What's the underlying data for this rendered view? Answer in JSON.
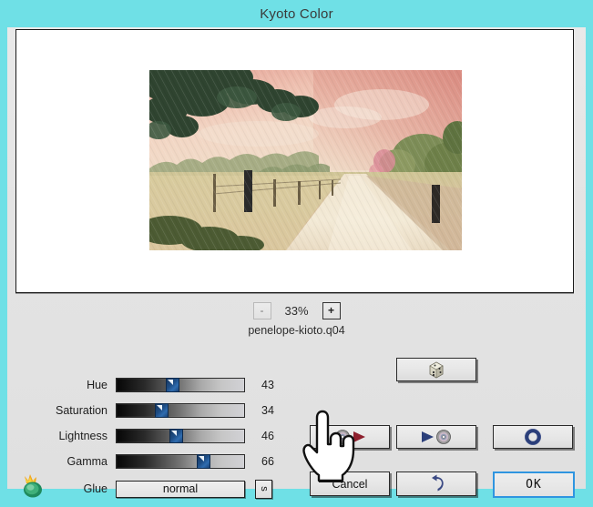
{
  "window": {
    "title": "Kyoto Color",
    "titlebar_color": "#6fe0e6",
    "panel_color": "#e5e5e5"
  },
  "preview": {
    "image_name": "penelope-kioto.q04",
    "background": "#ffffff",
    "description": "landscape painting of a dirt road with fence posts, trees and pink sky"
  },
  "zoom": {
    "minus_label": "-",
    "value": "33%",
    "plus_label": "+"
  },
  "sliders": [
    {
      "label": "Hue",
      "value": "43",
      "percent": 43
    },
    {
      "label": "Saturation",
      "value": "34",
      "percent": 34
    },
    {
      "label": "Lightness",
      "value": "46",
      "percent": 46
    },
    {
      "label": "Gamma",
      "value": "66",
      "percent": 66
    }
  ],
  "glue": {
    "label": "Glue",
    "value": "normal",
    "side_button_label": "s"
  },
  "buttons": {
    "randomize": {
      "icon": "dice-icon"
    },
    "preview_play": {
      "icon": "play-cd-icon"
    },
    "apply_play": {
      "icon": "cd-play-icon"
    },
    "reset_ring": {
      "icon": "blue-ring-icon"
    },
    "undo": {
      "icon": "undo-arrow-icon"
    },
    "cancel": {
      "label": "Cancel"
    },
    "ok": {
      "label": "OK"
    }
  },
  "logo": {
    "name": "flame-leaf-logo"
  },
  "cursor": {
    "name": "hand-pointer-cursor"
  }
}
